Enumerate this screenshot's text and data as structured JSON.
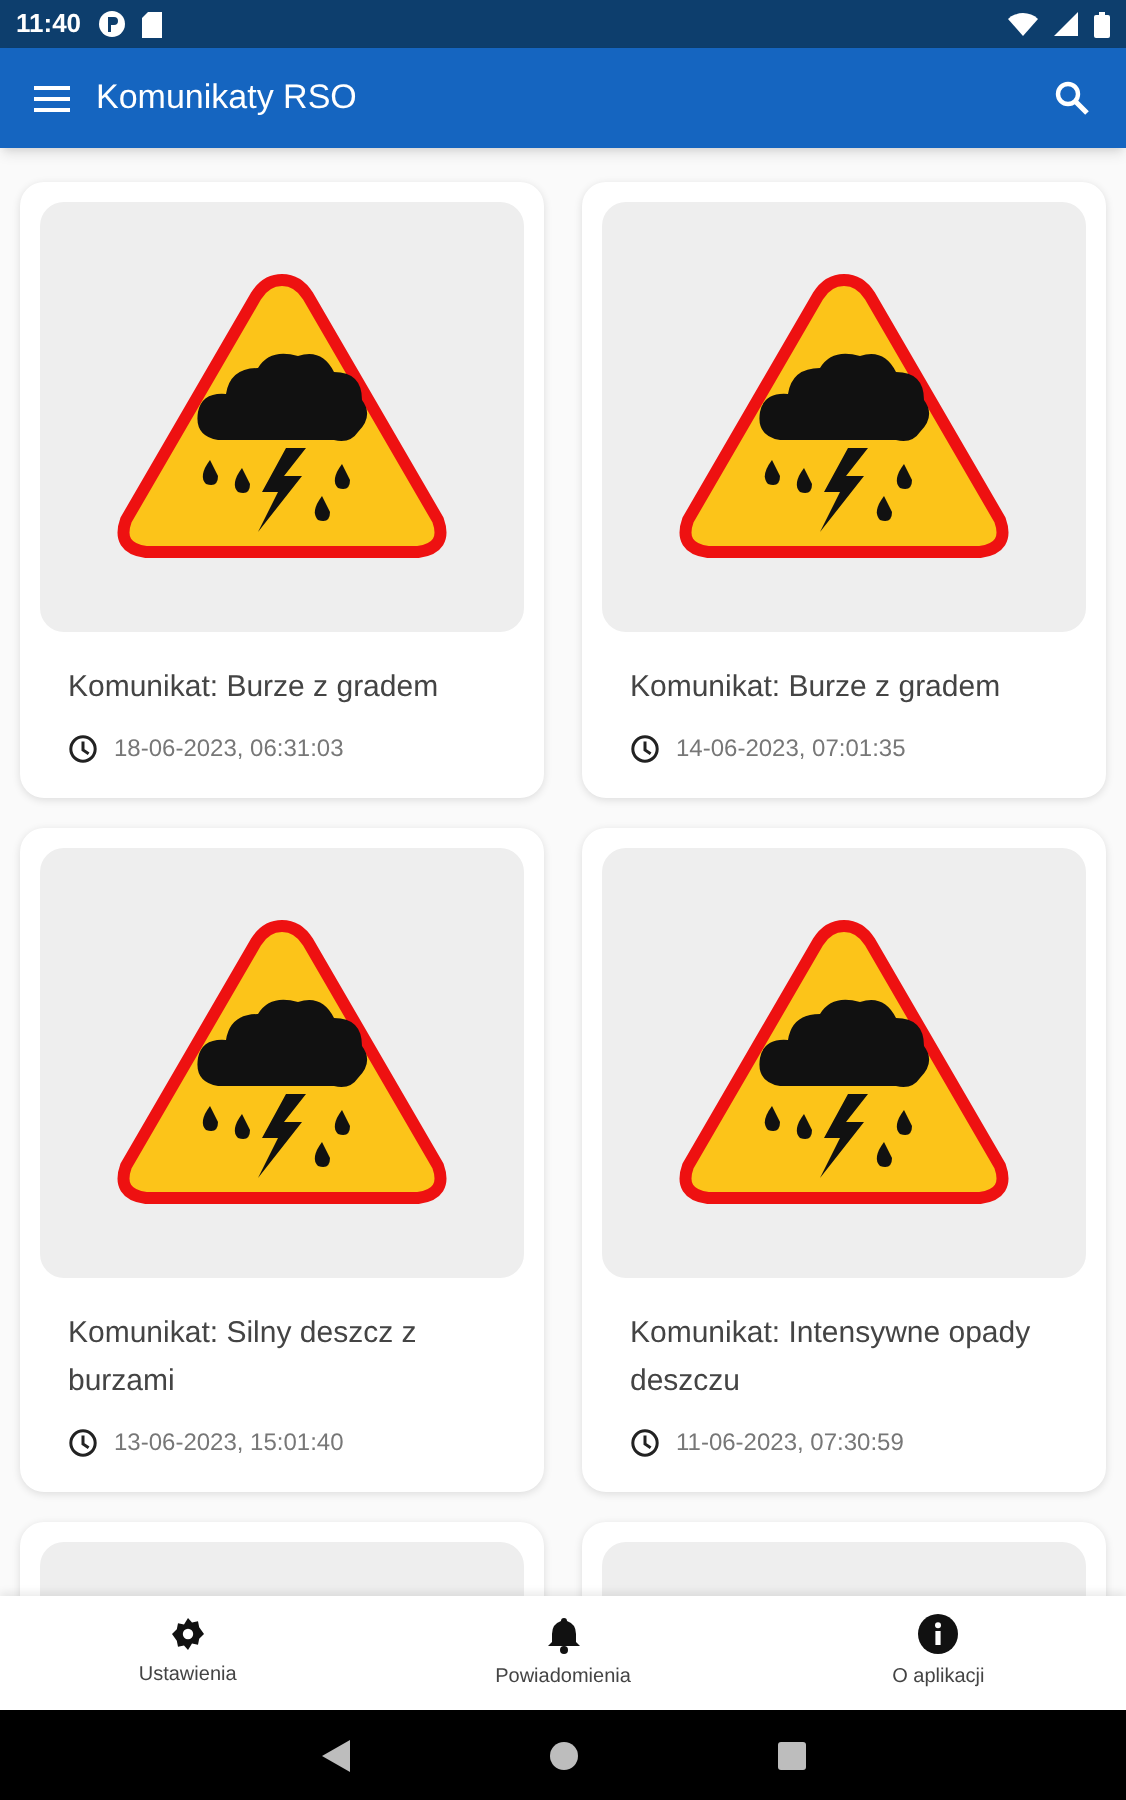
{
  "status_bar": {
    "time": "11:40"
  },
  "app_bar": {
    "title": "Komunikaty RSO"
  },
  "messages": [
    {
      "kind": "full",
      "title": "Komunikat: Burze z gradem",
      "date": "18-06-2023, 06:31:03"
    },
    {
      "kind": "full",
      "title": "Komunikat: Burze z gradem",
      "date": "14-06-2023, 07:01:35"
    },
    {
      "kind": "full",
      "title": "Komunikat: Silny deszcz z burzami",
      "date": "13-06-2023, 15:01:40"
    },
    {
      "kind": "full",
      "title": "Komunikat: Intensywne opady deszczu",
      "date": "11-06-2023, 07:30:59"
    },
    {
      "kind": "partial"
    },
    {
      "kind": "partial"
    }
  ],
  "bottom_nav": [
    {
      "label": "Ustawienia",
      "kind": "settings"
    },
    {
      "label": "Powiadomienia",
      "kind": "bell"
    },
    {
      "label": "O aplikacji",
      "kind": "info"
    }
  ]
}
